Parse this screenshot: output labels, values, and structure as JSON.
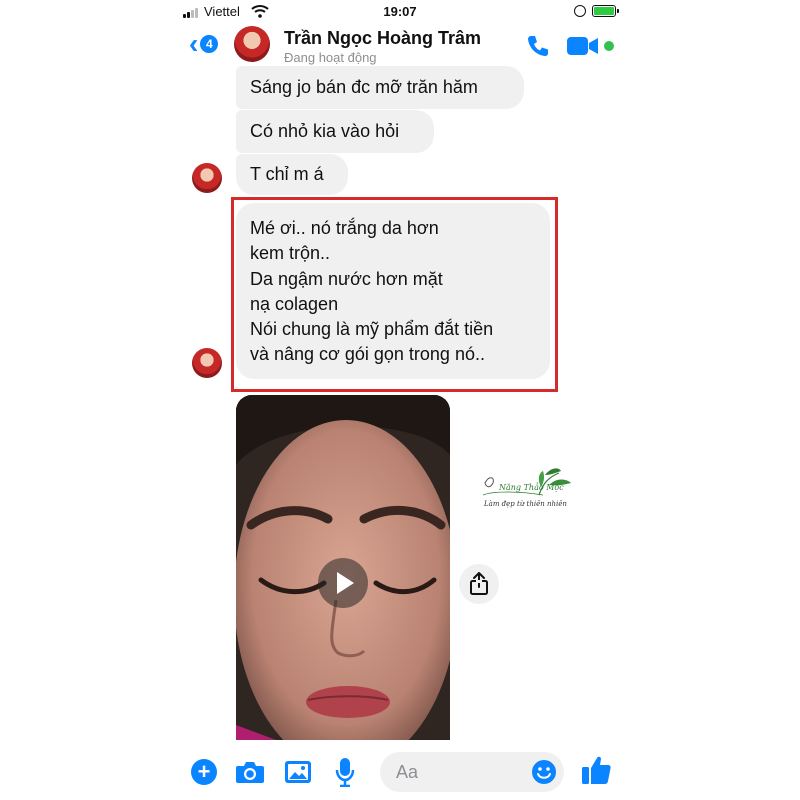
{
  "status_bar": {
    "carrier": "Viettel",
    "time": "19:07",
    "icons": [
      "signal-icon",
      "wifi-icon",
      "rotation-lock-icon",
      "battery-icon"
    ]
  },
  "header": {
    "back_count": "4",
    "contact_name": "Trần Ngọc Hoàng Trâm",
    "contact_status": "Đang hoạt động",
    "icons": [
      "back-chevron-icon",
      "phone-icon",
      "video-camera-icon"
    ]
  },
  "messages": [
    {
      "text": "Sáng jo bán đc mỡ trăn hăm"
    },
    {
      "text": "Có nhỏ kia vào hỏi"
    },
    {
      "text": "T chỉ m á"
    },
    {
      "lines": [
        "Mé ơi.. nó trắng da hơn",
        "kem trộn..",
        "Da ngậm nước hơn mặt",
        "nạ colagen",
        "Nói chung là mỹ phẩm đắt tiền",
        "và nâng cơ gói gọn trong nó.."
      ]
    }
  ],
  "watermark": {
    "brand": "Năng Thảo Mộc",
    "tagline": "Làm đẹp từ thiên nhiên"
  },
  "composer": {
    "placeholder": "Aa",
    "icons": [
      "plus-icon",
      "camera-icon",
      "gallery-icon",
      "microphone-icon",
      "emoji-icon",
      "thumbs-up-icon"
    ]
  },
  "colors": {
    "accent": "#0a84ff",
    "bubble": "#f0f0f0",
    "highlight": "#d62b2b",
    "online": "#31c24d"
  }
}
